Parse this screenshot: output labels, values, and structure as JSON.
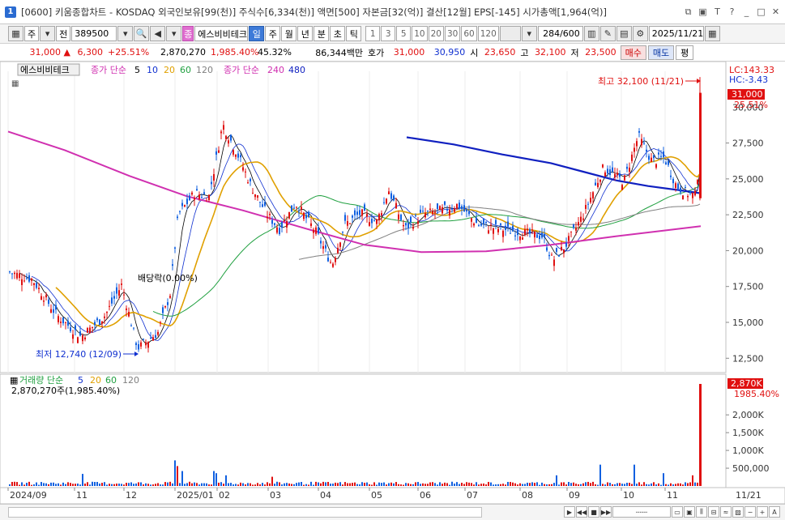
{
  "window": {
    "title": "[0600] 키움종합차트 - KOSDAQ 외국인보유[99(천)] 주식수[6,334(천)] 액면[500] 자본금[32(억)] 결산[12월] EPS[-145] 시가총액[1,964(억)]",
    "icon_label": "1"
  },
  "toolbar": {
    "mode_label": "주",
    "prev_label": "전",
    "code_value": "389500",
    "stock_name": "에스비비테크",
    "period_tabs": [
      "일",
      "주",
      "월",
      "년",
      "분",
      "초",
      "틱"
    ],
    "active_period": "일",
    "interval_buttons": [
      "1",
      "3",
      "5",
      "10",
      "20",
      "30",
      "60",
      "120"
    ],
    "count_value": "284",
    "count_total": "/600",
    "date_value": "2025/11/21"
  },
  "quote": {
    "price": "31,000",
    "change": "6,300",
    "change_pct": "+25.51%",
    "volume": "2,870,270",
    "volume_pct": "1,985.40%",
    "turnover_pct": "45.32%",
    "amount": "86,344백만",
    "ask_label": "호가",
    "ask": "31,000",
    "bid": "30,950",
    "open_label": "시",
    "open": "23,650",
    "high_label": "고",
    "high": "32,100",
    "low_label": "저",
    "low": "23,500",
    "buy_label": "매수",
    "sell_label": "매도",
    "avg_label": "평"
  },
  "price_panel": {
    "stock_tag": "에스비비테크",
    "ma_label": "종가 단순",
    "ma_periods": [
      "5",
      "10",
      "20",
      "60",
      "120"
    ],
    "ma_long_label": "종가 단순",
    "ma_long_periods": [
      "240",
      "480"
    ],
    "lc_label": "LC:143.33",
    "hc_label": "HC:-3.43",
    "current_price_tag": "31,000",
    "current_pct_tag": "25.51%",
    "high_annotation": "최고 32,100 (11/21)",
    "low_annotation": "최저 12,740 (12/09)",
    "dividend_annotation": "배당락(0.00%)"
  },
  "volume_panel": {
    "label": "거래량 단순",
    "periods": [
      "5",
      "20",
      "60",
      "120"
    ],
    "current_volume_text": "2,870,270주(1,985.40%)",
    "volume_tag": "2,870K",
    "volume_pct_tag": "1985.40%"
  },
  "chart_data": {
    "type": "candlestick",
    "price_axis": {
      "min": 11500,
      "max": 32500,
      "ticks": [
        "27,500",
        "25,000",
        "22,500",
        "20,000",
        "17,500",
        "15,000",
        "12,500"
      ],
      "partial_tick": "30,000"
    },
    "volume_axis": {
      "max": 2870000,
      "ticks": [
        "2,000K",
        "1,500K",
        "1,000K",
        "500,000"
      ]
    },
    "x_labels": [
      "2024/09",
      "11",
      "12",
      "2025/01",
      "02",
      "03",
      "04",
      "05",
      "06",
      "07",
      "08",
      "09",
      "10",
      "11",
      "11/21"
    ],
    "highs": {
      "value": 32100,
      "date": "11/21"
    },
    "lows": {
      "value": 12740,
      "date": "12/09"
    },
    "ma_colors": {
      "ma5": "#000000",
      "ma10": "#1030d0",
      "ma20": "#e0a000",
      "ma60": "#20a040",
      "ma120": "#808080",
      "ma240": "#d030b0",
      "ma480": "#1020c0"
    },
    "up_color": "#e01010",
    "down_color": "#1060e0"
  }
}
